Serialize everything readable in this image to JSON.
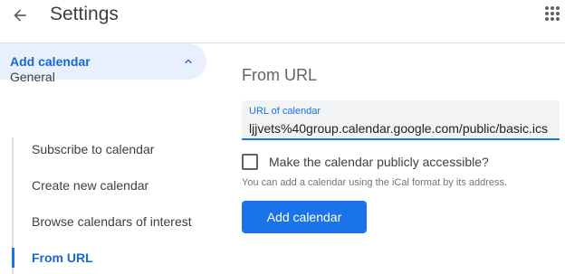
{
  "header": {
    "title": "Settings",
    "back_icon": "arrow-back-icon",
    "apps_icon": "apps-grid-icon"
  },
  "sidebar": {
    "general": "General",
    "add_calendar": "Add calendar",
    "add_calendar_icon": "chevron-up-icon",
    "sub_items": [
      "Subscribe to calendar",
      "Create new calendar",
      "Browse calendars of interest",
      "From URL"
    ]
  },
  "main": {
    "section_title": "From URL",
    "url_field": {
      "label": "URL of calendar",
      "value": "ljjvets%40group.calendar.google.com/public/basic.ics"
    },
    "checkbox_label": "Make the calendar publicly accessible?",
    "helper_text": "You can add a calendar using the iCal format by its address.",
    "add_button": "Add calendar"
  },
  "colors": {
    "accent": "#1a73e8",
    "selected_bg": "#e8f0fe",
    "text": "#3c4043"
  }
}
